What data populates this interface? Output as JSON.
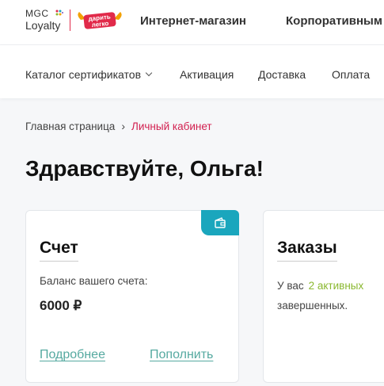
{
  "header": {
    "logo_mgc_line1": "MGC",
    "logo_mgc_line2": "Loyalty",
    "logo_partner_line1": "дарить",
    "logo_partner_line2": "легко",
    "nav": [
      "Интернет-магазин",
      "Корпоративным"
    ]
  },
  "subnav": {
    "items": [
      "Каталог сертификатов",
      "Активация",
      "Доставка",
      "Оплата"
    ]
  },
  "breadcrumb": {
    "home": "Главная страница",
    "separator": "›",
    "current": "Личный кабинет"
  },
  "page": {
    "title": "Здравствуйте, Ольга!"
  },
  "account_card": {
    "title": "Счет",
    "balance_label": "Баланс вашего счета:",
    "balance_value": "6000 ₽",
    "link_more": "Подробнее",
    "link_topup": "Пополнить",
    "badge_icon": "wallet-icon"
  },
  "orders_card": {
    "title": "Заказы",
    "text_prefix": "У вас",
    "active_text": "2 активных",
    "text_line2": "завершенных."
  },
  "colors": {
    "accent_teal": "#1aa6bd",
    "link_teal": "#55a9a0",
    "breadcrumb_current": "#d21f4f",
    "active_green": "#8ab830",
    "logo_red": "#e12a4a"
  }
}
